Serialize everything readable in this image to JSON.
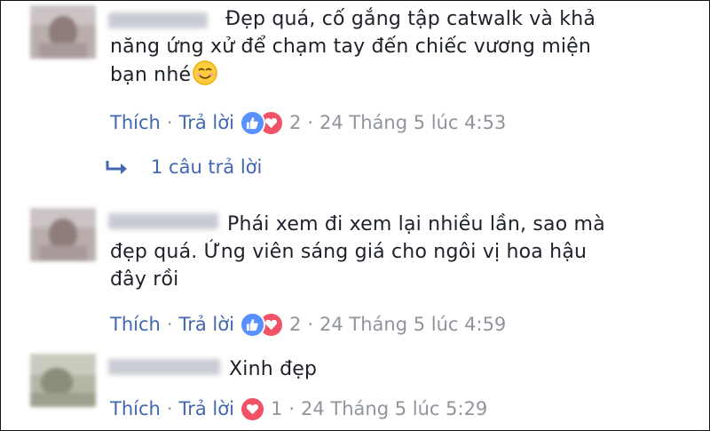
{
  "comments": [
    {
      "lines": [
        "Đẹp quá, cố gắng tập catwalk và khả",
        "năng ứng xử để chạm tay đến chiếc vương miện",
        "bạn nhé"
      ],
      "has_emoji": true,
      "like_label": "Thích",
      "reply_label": "Trả lời",
      "reaction_count": "2",
      "timestamp": "24 Tháng 5 lúc 4:53"
    },
    {
      "lines": [
        "Phái xem đi xem lại nhiều lần, sao mà",
        "đẹp quá. Ứng viên sáng giá cho ngôi vị hoa hậu",
        "đây rồi"
      ],
      "like_label": "Thích",
      "reply_label": "Trả lời",
      "reaction_count": "2",
      "timestamp": "24 Tháng 5 lúc 4:59"
    },
    {
      "lines": [
        "Xinh đẹp"
      ],
      "like_label": "Thích",
      "reply_label": "Trả lời",
      "reaction_count": "1",
      "timestamp": "24 Tháng 5 lúc 5:29"
    }
  ],
  "replies_link": "1 câu trả lời",
  "separator": "·",
  "colors": {
    "link": "#4267b2",
    "meta": "#90949c",
    "text": "#1d2129",
    "like": "#5890ff",
    "love": "#f25268"
  },
  "icons": {
    "like": "thumbs-up-icon",
    "love": "heart-icon",
    "reply": "reply-arrow-icon",
    "emoji": "smiling-face-icon"
  }
}
